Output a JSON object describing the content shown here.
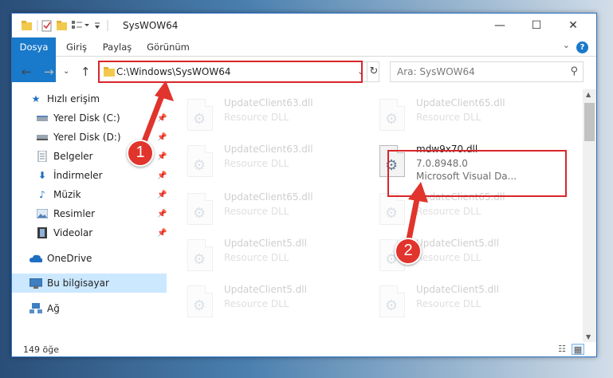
{
  "window": {
    "title": "SysWOW64",
    "controls": {
      "minimize": "—",
      "maximize": "☐",
      "close": "✕"
    }
  },
  "ribbon": {
    "tabs": [
      {
        "label": "Dosya"
      },
      {
        "label": "Giriş"
      },
      {
        "label": "Paylaş"
      },
      {
        "label": "Görünüm"
      }
    ],
    "help": "?"
  },
  "navigation": {
    "address": "C:\\Windows\\SysWOW64",
    "search_placeholder": "Ara: SysWOW64"
  },
  "sidebar": {
    "items": [
      {
        "label": "Hızlı erişim",
        "icon": "star-icon"
      },
      {
        "label": "Yerel Disk (C:)",
        "icon": "drive-icon",
        "pinned": true
      },
      {
        "label": "Yerel Disk (D:)",
        "icon": "drive-icon",
        "pinned": true
      },
      {
        "label": "Belgeler",
        "icon": "documents-icon",
        "pinned": true
      },
      {
        "label": "İndirmeler",
        "icon": "downloads-icon",
        "pinned": true
      },
      {
        "label": "Müzik",
        "icon": "music-icon",
        "pinned": true
      },
      {
        "label": "Resimler",
        "icon": "pictures-icon",
        "pinned": true
      },
      {
        "label": "Videolar",
        "icon": "videos-icon",
        "pinned": true
      },
      {
        "label": "OneDrive",
        "icon": "cloud-icon"
      },
      {
        "label": "Bu bilgisayar",
        "icon": "computer-icon",
        "selected": true
      },
      {
        "label": "Ağ",
        "icon": "network-icon"
      }
    ]
  },
  "files": [
    {
      "name": "UpdateClient63.dll",
      "type": "Resource DLL"
    },
    {
      "name": "UpdateClient65.dll",
      "type": "Resource DLL"
    },
    {
      "name": "UpdateClient63.dll",
      "type": "Resource DLL"
    },
    {
      "name": "mdw9x70.dll",
      "version": "7.0.8948.0",
      "description": "Microsoft Visual Da..."
    },
    {
      "name": "UpdateClient65.dll",
      "type": "Resource DLL"
    },
    {
      "name": "UpdateClient65.dll",
      "type": "Resource DLL"
    },
    {
      "name": "UpdateClient5.dll",
      "type": "Resource DLL"
    },
    {
      "name": "UpdateClient5.dll",
      "type": "Resource DLL"
    },
    {
      "name": "UpdateClient5.dll",
      "type": "Resource DLL"
    },
    {
      "name": "UpdateClient5.dll",
      "type": "Resource DLL"
    }
  ],
  "status": {
    "item_count": "149 öğe"
  },
  "callouts": {
    "first": "1",
    "second": "2"
  },
  "colors": {
    "accent": "#1979ca",
    "highlight": "#d9262a",
    "selected_bg": "#cce8ff"
  }
}
